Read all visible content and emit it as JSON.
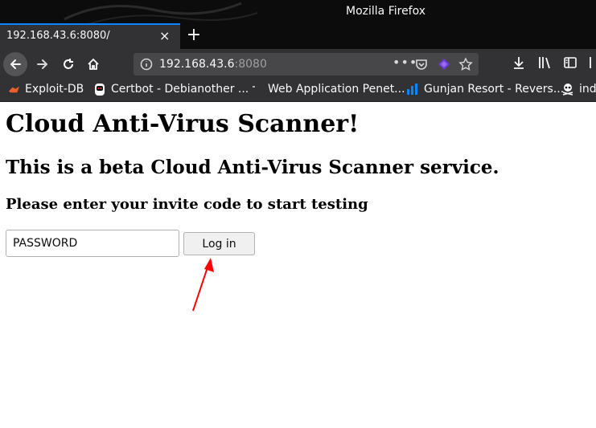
{
  "window": {
    "title": "Mozilla Firefox"
  },
  "tab": {
    "label": "192.168.43.6:8080/",
    "close": "×",
    "new_tab": "+"
  },
  "urlbar": {
    "host": "192.168.43.6",
    "port": ":8080",
    "more": "•••"
  },
  "bookmarks": [
    {
      "label": "Exploit-DB"
    },
    {
      "label": "Certbot - Debianother ..."
    },
    {
      "label": "Web Application Penet..."
    },
    {
      "label": "Gunjan Resort - Revers..."
    },
    {
      "label": "ind"
    }
  ],
  "page": {
    "heading": "Cloud Anti-Virus Scanner!",
    "subheading": "This is a beta Cloud Anti-Virus Scanner service.",
    "prompt": "Please enter your invite code to start testing",
    "password_value": "PASSWORD",
    "login_label": "Log in"
  },
  "colors": {
    "accent": "#0a84ff",
    "annotation_arrow": "#ff0000"
  }
}
